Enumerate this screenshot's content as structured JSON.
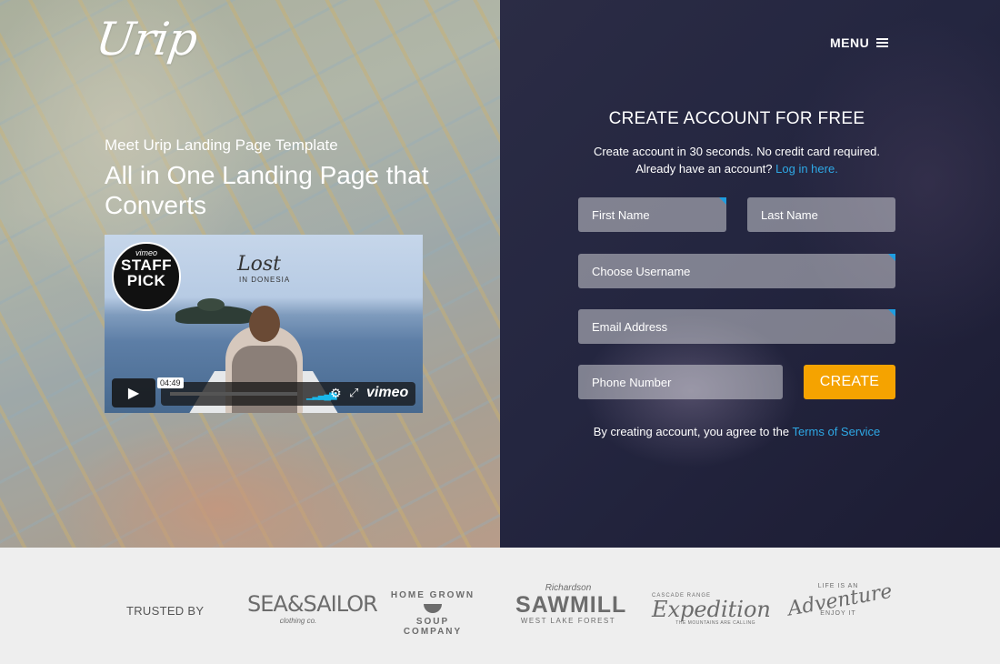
{
  "brand": {
    "logo": "Urip"
  },
  "nav": {
    "menu_label": "MENU"
  },
  "hero": {
    "tagline": "Meet Urip Landing Page Template",
    "headline": "All in One Landing Page that Converts"
  },
  "video": {
    "badge_top": "vimeo",
    "badge_main": "STAFF PICK",
    "title": "Lost",
    "title_sub": "IN DONESIA",
    "duration": "04:49",
    "provider": "vimeo"
  },
  "form": {
    "title": "CREATE ACCOUNT FOR FREE",
    "subtitle_line1": "Create account in 30 seconds. No credit card required.",
    "subtitle_line2": "Already have an account?",
    "login_link": "Log in here.",
    "first_name_placeholder": "First Name",
    "last_name_placeholder": "Last Name",
    "username_placeholder": "Choose Username",
    "email_placeholder": "Email Address",
    "phone_placeholder": "Phone Number",
    "submit_label": "CREATE",
    "terms_text": "By creating account, you agree to the",
    "terms_link": "Terms of Service"
  },
  "trusted": {
    "label": "TRUSTED BY",
    "brands": [
      {
        "main": "SEA&SAILOR",
        "sub": "clothing co."
      },
      {
        "top": "HOME GROWN",
        "bottom": "SOUP COMPANY"
      },
      {
        "top": "Richardson",
        "main": "SAWMILL",
        "sub": "WEST LAKE FOREST"
      },
      {
        "top": "CASCADE RANGE",
        "main": "Expedition",
        "sub": "THE MOUNTAINS ARE CALLING"
      },
      {
        "top": "LIFE IS AN",
        "main": "Adventure",
        "sub": "ENJOY IT"
      }
    ]
  },
  "colors": {
    "accent_button": "#f5a300",
    "link": "#2ea8e5",
    "required_marker": "#1f9de0",
    "right_panel": "#242640"
  },
  "icons": [
    "play-icon",
    "volume-icon",
    "settings-gear-icon",
    "fullscreen-icon",
    "menu-hamburger-icon"
  ]
}
